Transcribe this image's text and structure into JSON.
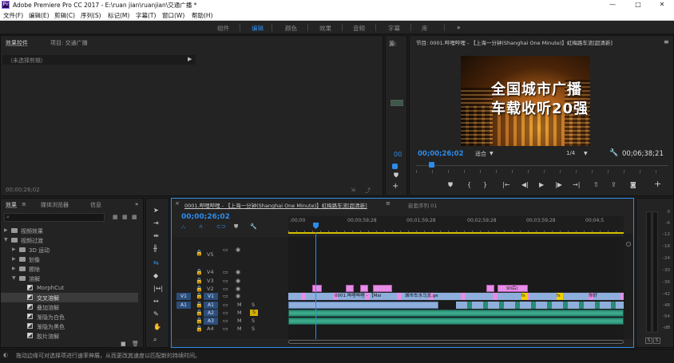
{
  "titlebar": {
    "icon_label": "Pr",
    "title": "Adobe Premiere Pro CC 2017 - E:\\ruan jian\\ruanjian\\交通广播 *",
    "min": "—",
    "max": "□",
    "close": "✕"
  },
  "menubar": [
    "文件(F)",
    "编辑(E)",
    "剪辑(C)",
    "序列(S)",
    "标记(M)",
    "字幕(T)",
    "窗口(W)",
    "帮助(H)"
  ],
  "workspaces": {
    "items": [
      "组件",
      "编辑",
      "颜色",
      "效果",
      "音频",
      "字幕",
      "库"
    ],
    "active": "编辑",
    "more": "»"
  },
  "effect_controls": {
    "tabs": [
      "效果控件",
      "项目: 交通广播"
    ],
    "no_clip": "（未选择剪辑）",
    "timecode": "00;00;26;02"
  },
  "source": {
    "label": "源:",
    "timecode": "00"
  },
  "program": {
    "title": "节目: 0001.哔哩哔哩 - 【上海一分钟(Shanghai One Minute)】虹梅路车流[超清新]",
    "overlay_line1": "全国城市广播",
    "overlay_line2": "车载收听20强",
    "timecode": "00;00;26;02",
    "fit": "适合",
    "resolution": "1/4",
    "duration": "00;06;38;21"
  },
  "effects_panel": {
    "tabs": [
      "效果",
      "媒体浏览器",
      "信息"
    ],
    "more": "»",
    "tree": [
      {
        "label": "视频效果",
        "level": 0,
        "type": "folder"
      },
      {
        "label": "视频过渡",
        "level": 0,
        "type": "folder"
      },
      {
        "label": "3D 运动",
        "level": 1,
        "type": "folder"
      },
      {
        "label": "划像",
        "level": 1,
        "type": "folder"
      },
      {
        "label": "擦除",
        "level": 1,
        "type": "folder"
      },
      {
        "label": "溶解",
        "level": 1,
        "type": "folder"
      },
      {
        "label": "MorphCut",
        "level": 2,
        "type": "item"
      },
      {
        "label": "交叉溶解",
        "level": 2,
        "type": "item",
        "selected": true
      },
      {
        "label": "叠加溶解",
        "level": 2,
        "type": "item"
      },
      {
        "label": "渐隐为白色",
        "level": 2,
        "type": "item"
      },
      {
        "label": "渐隐为黑色",
        "level": 2,
        "type": "item"
      },
      {
        "label": "胶片溶解",
        "level": 2,
        "type": "item"
      }
    ]
  },
  "timeline": {
    "tabs": [
      "0001.哔哩哔哩 - 【上海一分钟(Shanghai One Minute)】虹梅路车流[超清新]",
      "嵌套序列 01"
    ],
    "timecode": "00;00;26;02",
    "ruler": [
      ";00;00",
      "00;00;59;28",
      "00;01;59;28",
      "00;02;59;28",
      "00;03;59;28",
      "00;04;5"
    ],
    "video_tracks": [
      "V5",
      "V4",
      "V3",
      "V2",
      "V1"
    ],
    "audio_tracks": [
      "A1",
      "A2",
      "A3",
      "A4"
    ],
    "source_v": "V1",
    "source_a": "A1",
    "m": "M",
    "s": "S",
    "clip_v1_a": "0001.哔哩哔哩 - 【Mai",
    "clip_v1_b": "城市车水马龙.ge",
    "clip_v1_c": "你好",
    "clip_v2": "90后(",
    "fx": "fx"
  },
  "vu_meter": {
    "ticks": [
      "0",
      "-6",
      "-12",
      "-18",
      "-24",
      "-30",
      "-36",
      "-42",
      "-48",
      "-54",
      "-dB"
    ],
    "solo_left": "S",
    "solo_right": "S"
  },
  "status": "拖动边缘可对选择项进行速率伸展，从而更改其速度以匹配新的持续时间。"
}
